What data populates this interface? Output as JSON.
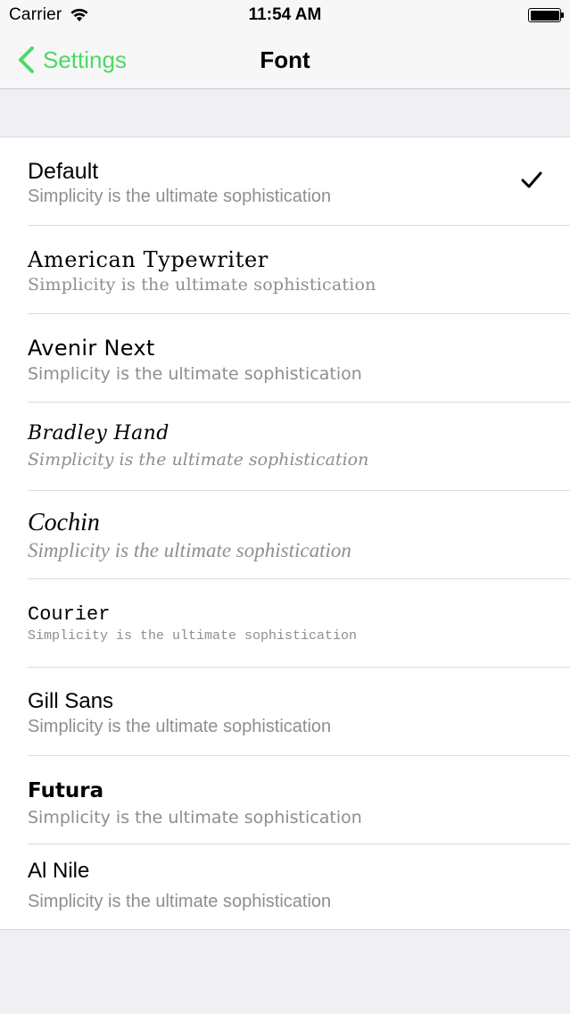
{
  "status_bar": {
    "carrier": "Carrier",
    "time": "11:54 AM"
  },
  "nav": {
    "back_label": "Settings",
    "title": "Font"
  },
  "colors": {
    "accent": "#4cd964",
    "subtitle": "#8e8e93",
    "background": "#efeff4"
  },
  "fonts": [
    {
      "name": "Default",
      "sample": "Simplicity is the ultimate sophistication",
      "selected": true
    },
    {
      "name": "American Typewriter",
      "sample": "Simplicity is the ultimate sophistication",
      "selected": false
    },
    {
      "name": "Avenir Next",
      "sample": "Simplicity is the ultimate sophistication",
      "selected": false
    },
    {
      "name": "Bradley Hand",
      "sample": "Simplicity is the ultimate sophistication",
      "selected": false
    },
    {
      "name": "Cochin",
      "sample": "Simplicity is the ultimate sophistication",
      "selected": false
    },
    {
      "name": "Courier",
      "sample": "Simplicity is the ultimate sophistication",
      "selected": false
    },
    {
      "name": "Gill Sans",
      "sample": "Simplicity is the ultimate sophistication",
      "selected": false
    },
    {
      "name": "Futura",
      "sample": "Simplicity is the ultimate sophistication",
      "selected": false
    },
    {
      "name": "Al Nile",
      "sample": "Simplicity is the ultimate sophistication",
      "selected": false
    }
  ],
  "icons": {
    "back": "chevron-left-icon",
    "selected": "checkmark-icon",
    "wifi": "wifi-icon",
    "battery": "battery-icon"
  }
}
